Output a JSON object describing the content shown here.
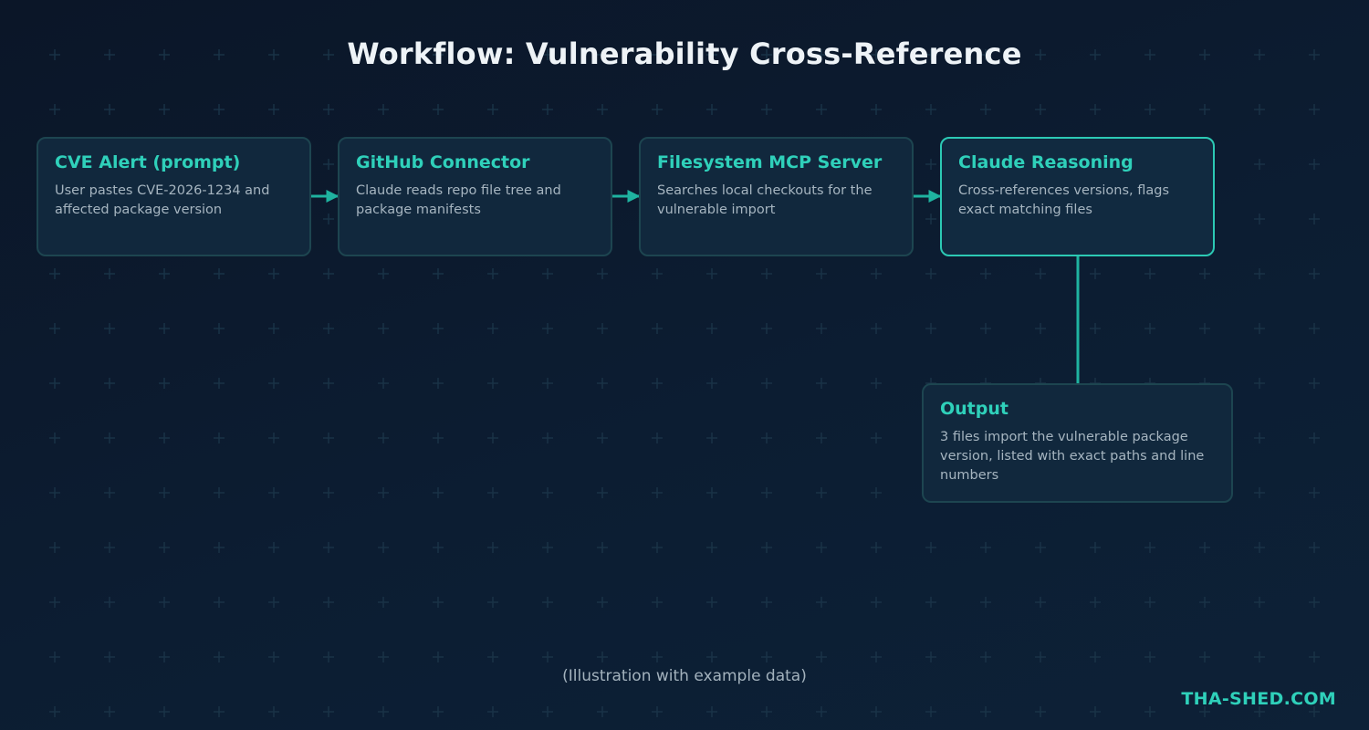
{
  "diagram": {
    "title": "Workflow: Vulnerability Cross-Reference",
    "nodes": [
      {
        "id": "cve-alert",
        "title": "CVE Alert (prompt)",
        "description": "User pastes CVE-2026-1234 and affected package version"
      },
      {
        "id": "github-connector",
        "title": "GitHub Connector",
        "description": "Claude reads repo file tree and package manifests"
      },
      {
        "id": "filesystem-mcp",
        "title": "Filesystem MCP Server",
        "description": "Searches local checkouts for the vulnerable import"
      },
      {
        "id": "claude-reasoning",
        "title": "Claude Reasoning",
        "description": "Cross-references versions, flags exact matching files"
      },
      {
        "id": "output",
        "title": "Output",
        "description": "3 files import the vulnerable package version, listed with exact paths and line numbers"
      }
    ],
    "edges": [
      {
        "from": "cve-alert",
        "to": "github-connector"
      },
      {
        "from": "github-connector",
        "to": "filesystem-mcp"
      },
      {
        "from": "filesystem-mcp",
        "to": "claude-reasoning"
      },
      {
        "from": "claude-reasoning",
        "to": "output"
      }
    ],
    "highlighted_node": "claude-reasoning",
    "caption": "(Illustration with example data)",
    "brand": "THA-SHED.COM"
  },
  "colors": {
    "background": "#0c1d32",
    "accent": "#2cc9b4",
    "node_fill": "#11283d",
    "node_border": "#1d4550",
    "title_text": "#eef3f7",
    "body_text": "#a6b5c0"
  }
}
